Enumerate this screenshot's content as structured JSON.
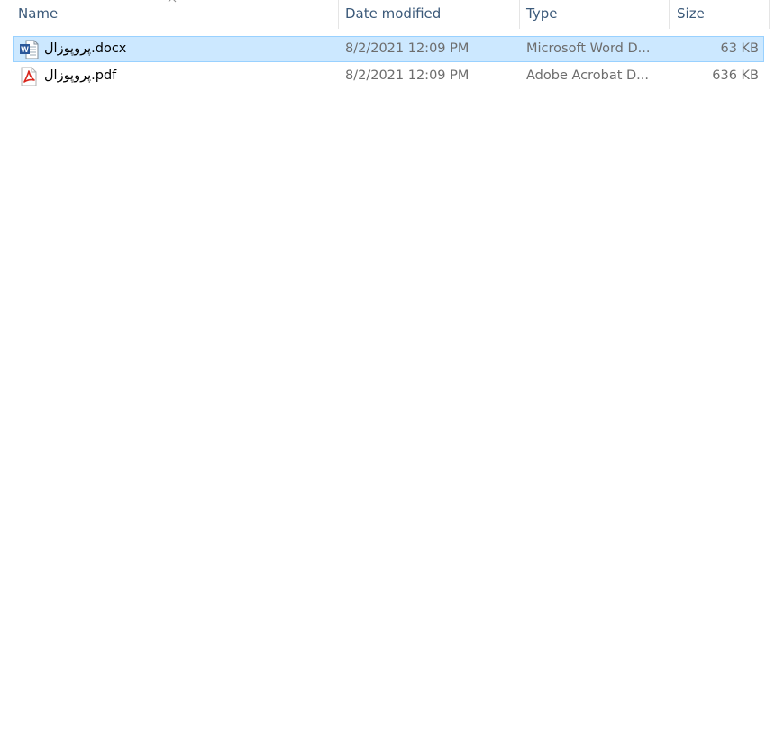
{
  "columns": {
    "name": "Name",
    "date_modified": "Date modified",
    "type": "Type",
    "size": "Size"
  },
  "sort": {
    "column": "name",
    "direction": "ascending",
    "icon": "chevron-up-icon"
  },
  "files": [
    {
      "name": "پروپوزال.docx",
      "date_modified": "8/2/2021 12:09 PM",
      "type": "Microsoft Word D...",
      "size": "63 KB",
      "icon": "word-document-icon",
      "selected": true
    },
    {
      "name": "پروپوزال.pdf",
      "date_modified": "8/2/2021 12:09 PM",
      "type": "Adobe Acrobat D...",
      "size": "636 KB",
      "icon": "pdf-document-icon",
      "selected": false
    }
  ],
  "colors": {
    "selection_bg": "#cce8ff",
    "selection_border": "#99d1ff",
    "header_text": "#3c5a7a",
    "word_blue": "#2b579a",
    "pdf_red": "#d9261c"
  }
}
